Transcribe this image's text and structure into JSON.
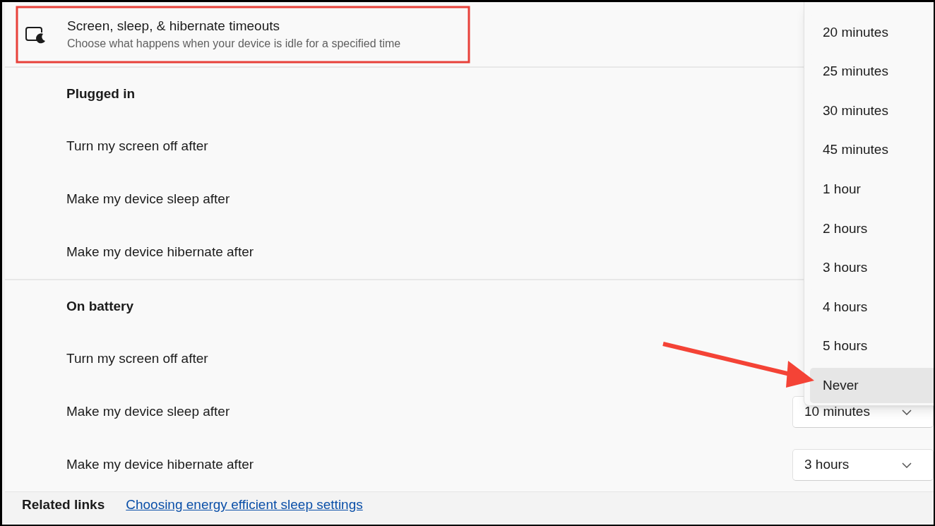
{
  "header": {
    "title": "Screen, sleep, & hibernate timeouts",
    "subtitle": "Choose what happens when your device is idle for a specified time"
  },
  "sections": [
    {
      "title": "Plugged in",
      "rows": [
        {
          "label": "Turn my screen off after"
        },
        {
          "label": "Make my device sleep after"
        },
        {
          "label": "Make my device hibernate after"
        }
      ]
    },
    {
      "title": "On battery",
      "rows": [
        {
          "label": "Turn my screen off after"
        },
        {
          "label": "Make my device sleep after",
          "value": "10 minutes"
        },
        {
          "label": "Make my device hibernate after",
          "value": "3 hours"
        }
      ]
    }
  ],
  "flyout": {
    "options": [
      {
        "label": "20 minutes",
        "selected": false
      },
      {
        "label": "25 minutes",
        "selected": false
      },
      {
        "label": "30 minutes",
        "selected": false
      },
      {
        "label": "45 minutes",
        "selected": false
      },
      {
        "label": "1 hour",
        "selected": false
      },
      {
        "label": "2 hours",
        "selected": false
      },
      {
        "label": "3 hours",
        "selected": false
      },
      {
        "label": "4 hours",
        "selected": false
      },
      {
        "label": "5 hours",
        "selected": false
      },
      {
        "label": "Never",
        "selected": true
      }
    ]
  },
  "related_links": {
    "label": "Related links",
    "link": "Choosing energy efficient sleep settings"
  }
}
